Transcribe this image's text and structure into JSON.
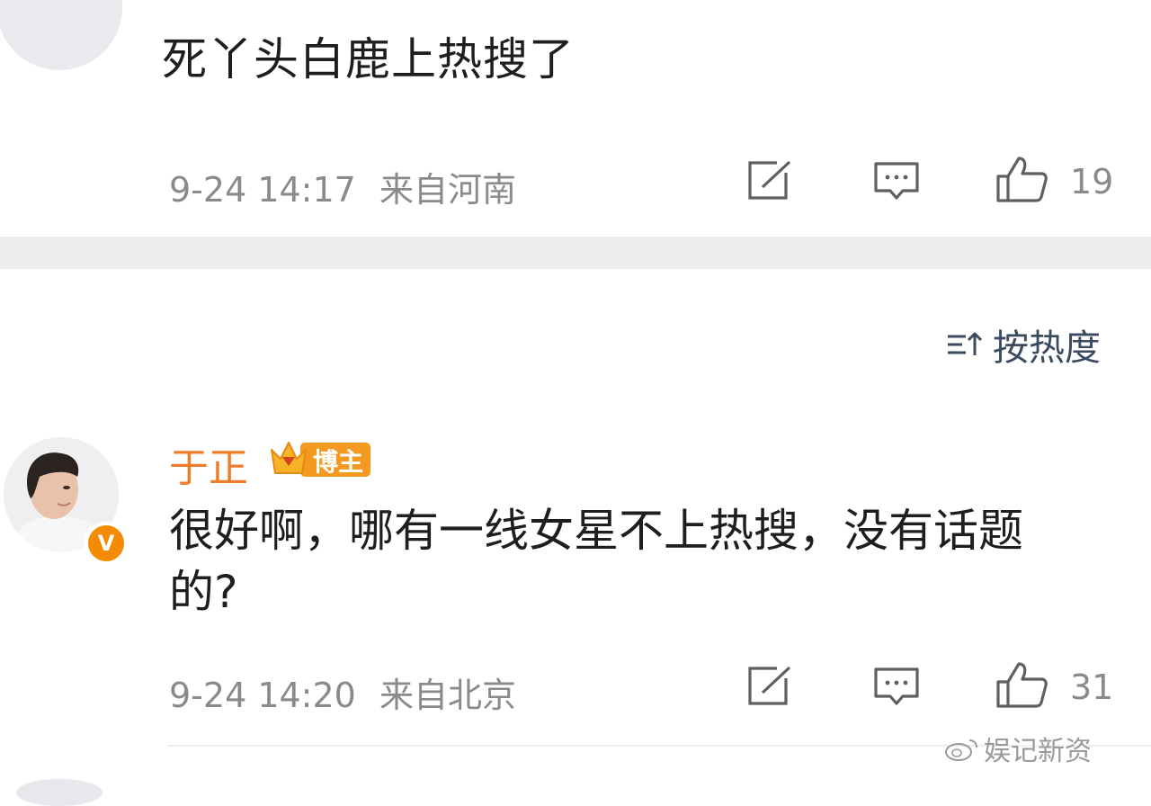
{
  "comment1": {
    "text": "死丫头白鹿上热搜了",
    "timestamp": "9-24 14:17",
    "location": "来自河南",
    "like_count": "19"
  },
  "sort": {
    "label": "按热度"
  },
  "comment2": {
    "username": "于正",
    "badge_label": "博主",
    "verified_mark": "V",
    "text": "很好啊，哪有一线女星不上热搜，没有话题的?",
    "timestamp": "9-24 14:20",
    "location": "来自北京",
    "like_count": "31"
  },
  "watermark": {
    "text": "娱记新资"
  },
  "colors": {
    "username": "#ee7c2a",
    "badge": "#f59a20",
    "verified": "#f58b05",
    "sort_text": "#3c4a60",
    "meta_text": "#8a8a8a"
  },
  "icons": [
    "share-icon",
    "comment-icon",
    "like-icon",
    "sort-icon",
    "weibo-logo-icon"
  ]
}
